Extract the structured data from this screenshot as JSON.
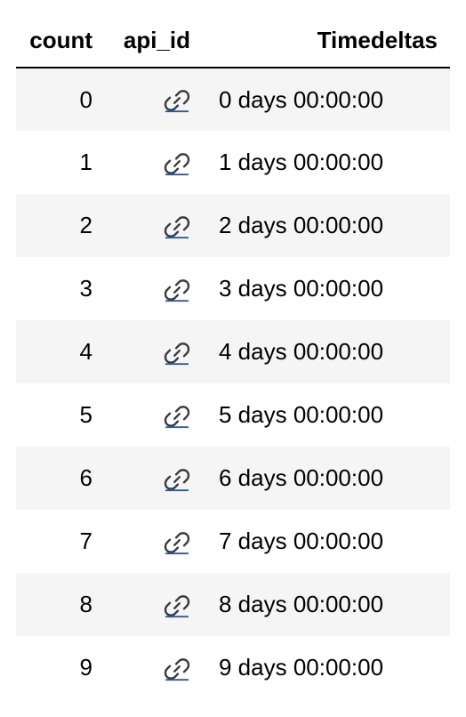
{
  "columns": {
    "count": "count",
    "api_id": "api_id",
    "timedeltas": "Timedeltas"
  },
  "icon_name": "link-icon",
  "rows": [
    {
      "count": "0",
      "timedelta": "0 days 00:00:00"
    },
    {
      "count": "1",
      "timedelta": "1 days 00:00:00"
    },
    {
      "count": "2",
      "timedelta": "2 days 00:00:00"
    },
    {
      "count": "3",
      "timedelta": "3 days 00:00:00"
    },
    {
      "count": "4",
      "timedelta": "4 days 00:00:00"
    },
    {
      "count": "5",
      "timedelta": "5 days 00:00:00"
    },
    {
      "count": "6",
      "timedelta": "6 days 00:00:00"
    },
    {
      "count": "7",
      "timedelta": "7 days 00:00:00"
    },
    {
      "count": "8",
      "timedelta": "8 days 00:00:00"
    },
    {
      "count": "9",
      "timedelta": "9 days 00:00:00"
    }
  ],
  "chart_data": {
    "type": "table",
    "columns": [
      "count",
      "api_id",
      "Timedeltas"
    ],
    "data": [
      [
        0,
        "link",
        "0 days 00:00:00"
      ],
      [
        1,
        "link",
        "1 days 00:00:00"
      ],
      [
        2,
        "link",
        "2 days 00:00:00"
      ],
      [
        3,
        "link",
        "3 days 00:00:00"
      ],
      [
        4,
        "link",
        "4 days 00:00:00"
      ],
      [
        5,
        "link",
        "5 days 00:00:00"
      ],
      [
        6,
        "link",
        "6 days 00:00:00"
      ],
      [
        7,
        "link",
        "7 days 00:00:00"
      ],
      [
        8,
        "link",
        "8 days 00:00:00"
      ],
      [
        9,
        "link",
        "9 days 00:00:00"
      ]
    ]
  }
}
